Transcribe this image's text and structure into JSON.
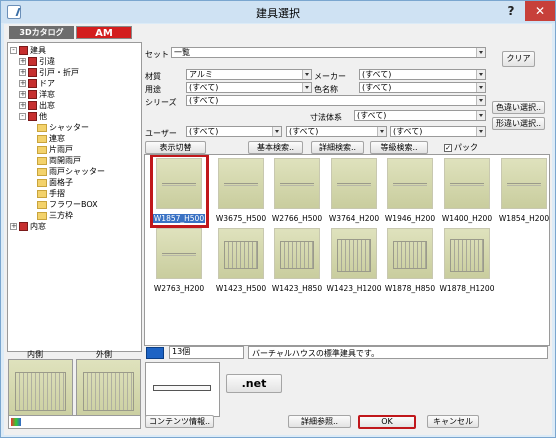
{
  "window": {
    "title": "建具選択",
    "help": "?",
    "close": "✕"
  },
  "tabs": {
    "catalog": "3Dカタログ",
    "am": "AM"
  },
  "tree": [
    {
      "label": "建具",
      "icon": "book",
      "pm": "-",
      "indent": 0
    },
    {
      "label": "引違",
      "icon": "book",
      "pm": "+",
      "indent": 1
    },
    {
      "label": "引戸・折戸",
      "icon": "book",
      "pm": "+",
      "indent": 1
    },
    {
      "label": "ドア",
      "icon": "book",
      "pm": "+",
      "indent": 1
    },
    {
      "label": "洋窓",
      "icon": "book",
      "pm": "+",
      "indent": 1
    },
    {
      "label": "出窓",
      "icon": "book",
      "pm": "+",
      "indent": 1
    },
    {
      "label": "他",
      "icon": "book",
      "pm": "-",
      "indent": 1
    },
    {
      "label": "シャッター",
      "icon": "folder",
      "pm": "",
      "indent": 2
    },
    {
      "label": "連窓",
      "icon": "folder",
      "pm": "",
      "indent": 2
    },
    {
      "label": "片雨戸",
      "icon": "folder",
      "pm": "",
      "indent": 2
    },
    {
      "label": "両開雨戸",
      "icon": "folder",
      "pm": "",
      "indent": 2
    },
    {
      "label": "雨戸シャッター",
      "icon": "folder",
      "pm": "",
      "indent": 2
    },
    {
      "label": "面格子",
      "icon": "folder",
      "pm": "",
      "indent": 2
    },
    {
      "label": "手摺",
      "icon": "folder",
      "pm": "",
      "indent": 2
    },
    {
      "label": "フラワーBOX",
      "icon": "folder",
      "pm": "",
      "indent": 2
    },
    {
      "label": "三方枠",
      "icon": "folder",
      "pm": "",
      "indent": 2
    },
    {
      "label": "内窓",
      "icon": "book",
      "pm": "+",
      "indent": 0
    }
  ],
  "filters": {
    "set_label": "セット",
    "set_value": "一覧",
    "clear": "クリア",
    "material_label": "材質",
    "material_value": "アルミ",
    "maker_label": "メーカー",
    "maker_value": "(すべて)",
    "usage_label": "用途",
    "usage_value": "(すべて)",
    "color_label": "色名称",
    "color_value": "(すべて)",
    "series_label": "シリーズ",
    "series_value": "(すべて)",
    "size_label": "寸法体系",
    "size_value": "(すべて)",
    "user_label": "ユーザー",
    "user_value1": "(すべて)",
    "user_value2": "(すべて)",
    "user_value3": "(すべて)",
    "color_btn": "色違い選択..",
    "shape_btn": "形違い選択.."
  },
  "toolbar": {
    "toggle": "表示切替",
    "basic": "基本検索..",
    "detail": "詳細検索..",
    "grade": "等級検索..",
    "pack_check": "✓",
    "pack": "パック"
  },
  "items": [
    {
      "name": "W1857_H500",
      "kind": "low"
    },
    {
      "name": "W3675_H500",
      "kind": "low"
    },
    {
      "name": "W2766_H500",
      "kind": "low"
    },
    {
      "name": "W3764_H200",
      "kind": "low"
    },
    {
      "name": "W1946_H200",
      "kind": "low"
    },
    {
      "name": "W1400_H200",
      "kind": "low"
    },
    {
      "name": "W1854_H200",
      "kind": "low"
    },
    {
      "name": "W2763_H200",
      "kind": "low"
    },
    {
      "name": "W1423_H500",
      "kind": "mid"
    },
    {
      "name": "W1423_H850",
      "kind": "mid"
    },
    {
      "name": "W1423_H1200",
      "kind": "tall"
    },
    {
      "name": "W1878_H850",
      "kind": "mid"
    },
    {
      "name": "W1878_H1200",
      "kind": "tall"
    }
  ],
  "bottom": {
    "inner": "内側",
    "outer": "外側",
    "count": "13個",
    "desc": "バーチャルハウスの標準建具です。",
    "net": ".net",
    "content_info": "コンテンツ情報..",
    "detail_ref": "詳細参照..",
    "ok": "OK",
    "cancel": "キャンセル"
  }
}
